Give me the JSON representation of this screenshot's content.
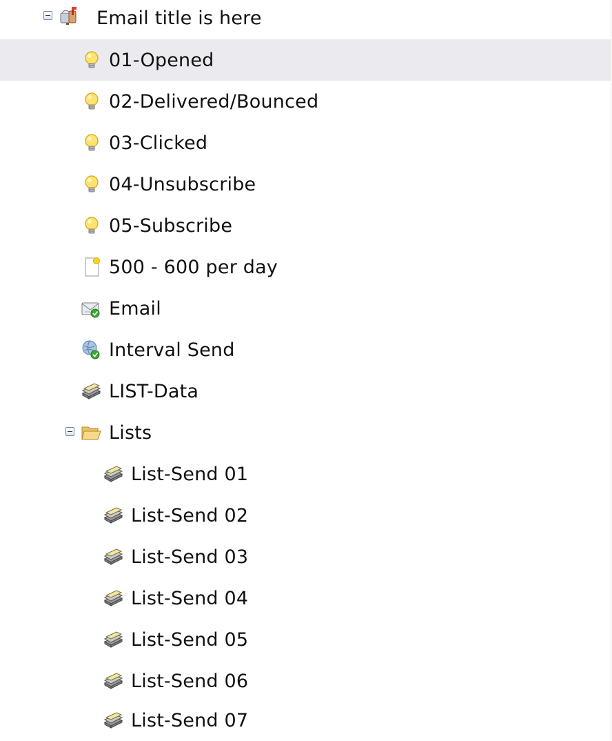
{
  "root": {
    "label": "Email title is here",
    "icon": "mailbox-icon",
    "expanded": true
  },
  "items": [
    {
      "label": "01-Opened",
      "icon": "lightbulb-icon",
      "selected": true
    },
    {
      "label": "02-Delivered/Bounced",
      "icon": "lightbulb-icon"
    },
    {
      "label": "03-Clicked",
      "icon": "lightbulb-icon"
    },
    {
      "label": "04-Unsubscribe",
      "icon": "lightbulb-icon"
    },
    {
      "label": "05-Subscribe",
      "icon": "lightbulb-icon"
    },
    {
      "label": "500 - 600 per day",
      "icon": "new-document-icon"
    },
    {
      "label": "Email",
      "icon": "email-check-icon"
    },
    {
      "label": "Interval Send",
      "icon": "globe-check-icon"
    },
    {
      "label": "LIST-Data",
      "icon": "list-stack-icon"
    }
  ],
  "lists_folder": {
    "label": "Lists",
    "icon": "folder-open-icon",
    "expanded": true,
    "children": [
      {
        "label": "List-Send 01",
        "icon": "list-stack-icon"
      },
      {
        "label": "List-Send 02",
        "icon": "list-stack-icon"
      },
      {
        "label": "List-Send 03",
        "icon": "list-stack-icon"
      },
      {
        "label": "List-Send 04",
        "icon": "list-stack-icon"
      },
      {
        "label": "List-Send 05",
        "icon": "list-stack-icon"
      },
      {
        "label": "List-Send 06",
        "icon": "list-stack-icon"
      },
      {
        "label": "List-Send 07",
        "icon": "list-stack-icon"
      }
    ]
  },
  "colors": {
    "selected_row": "#ebebef",
    "toggle_border": "#6f87a8",
    "check_green": "#3aa832"
  }
}
